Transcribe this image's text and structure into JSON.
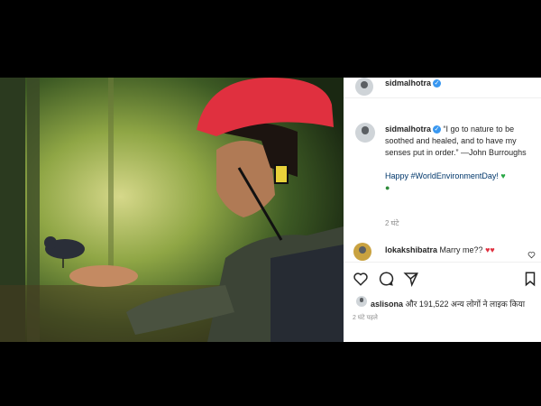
{
  "post": {
    "username": "sidmalhotra",
    "verified_icon": "verified-badge-icon",
    "caption_text": "“I go to nature to be soothed and healed, and to have my senses put in order.” —John Burroughs",
    "hashtag_line": "Happy #WorldEnvironmentDay!",
    "caption_time": "2 घंटे",
    "comment": {
      "username": "lokakshibatra",
      "text": "Marry me??"
    },
    "likes": {
      "username": "aslisona",
      "text": "और 191,522 अन्य लोगों ने लाइक किया"
    },
    "post_time": "2 घंटे पहले"
  },
  "colors": {
    "background": "#000000",
    "panel": "#ffffff",
    "verified": "#3897f0",
    "text": "#262626",
    "muted": "#8e8e8e",
    "hashtag": "#00376b",
    "helmet": "#e0303f"
  },
  "icons": [
    "heart-icon",
    "comment-icon",
    "share-icon",
    "save-icon",
    "green-heart-emoji",
    "red-heart-emoji"
  ]
}
